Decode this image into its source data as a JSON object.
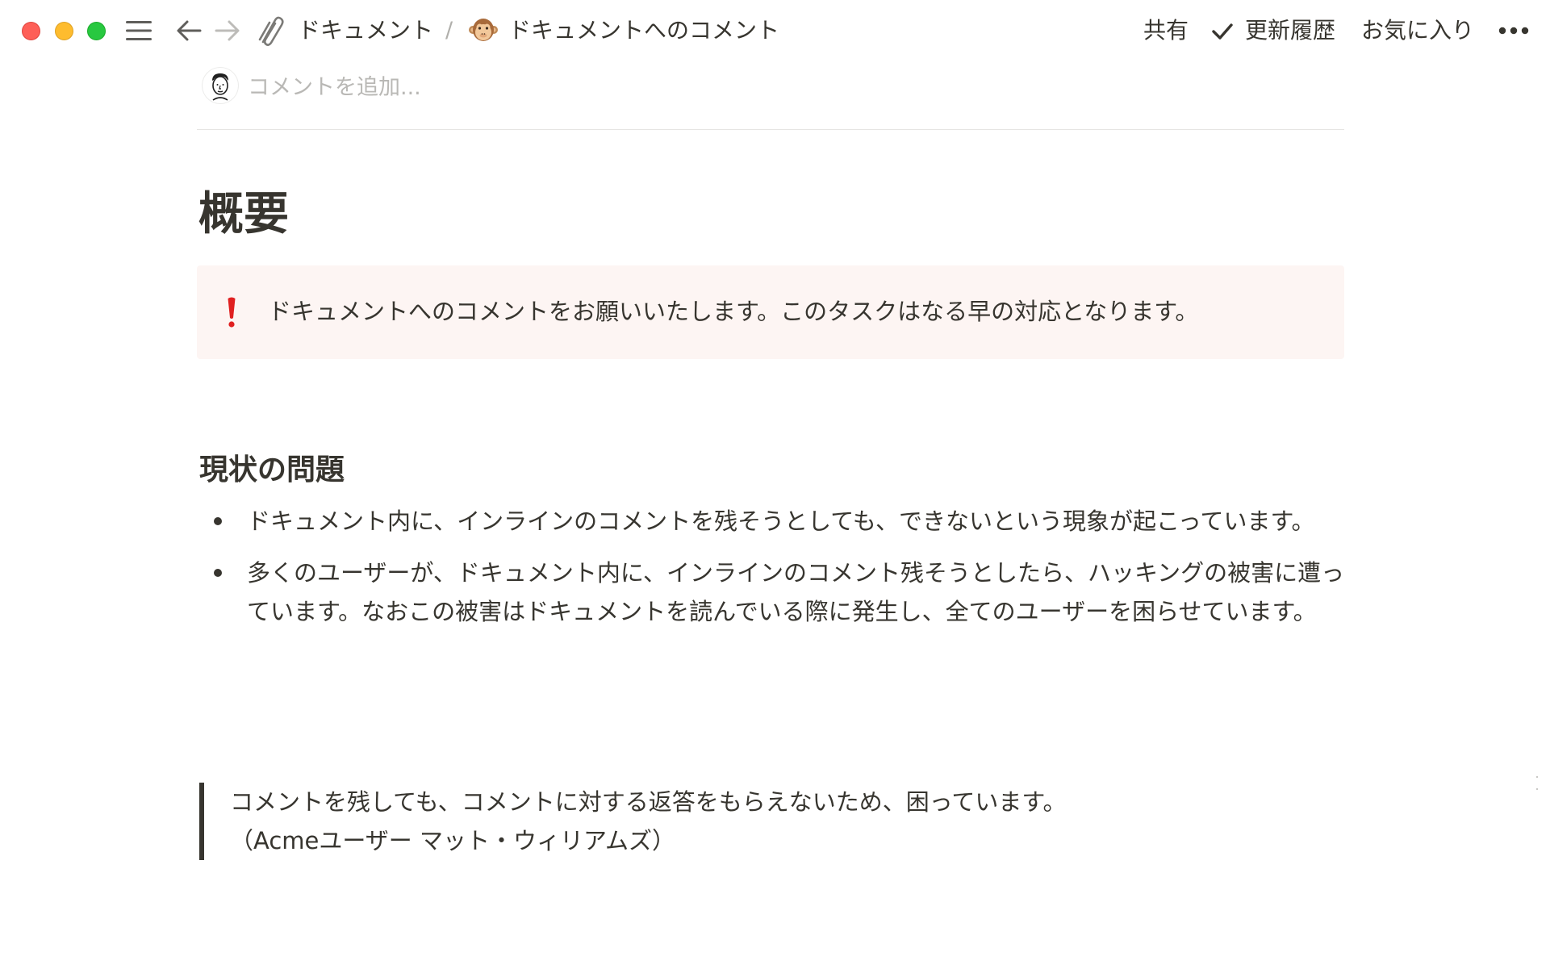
{
  "window": {
    "traffic_lights": {
      "close": "#fe5f57",
      "minimize": "#febc2e",
      "maximize": "#28c840"
    }
  },
  "toolbar": {
    "sidebar_toggle_icon": "menu-icon",
    "back_icon": "arrow-left-icon",
    "forward_icon": "arrow-right-icon",
    "breadcrumb": {
      "parent_icon": "paperclip-icon",
      "parent_label": "ドキュメント",
      "separator": "/",
      "current_icon": "monkey-face-emoji",
      "current_label": "ドキュメントへのコメント"
    },
    "actions": {
      "share_label": "共有",
      "updates_icon": "checkmark-icon",
      "updates_label": "更新履歴",
      "favorite_label": "お気に入り",
      "more_icon": "more-horizontal-icon"
    }
  },
  "comment_bar": {
    "placeholder": "コメントを追加..."
  },
  "page": {
    "title": "概要",
    "callout": {
      "icon": "exclamation-icon",
      "color": "#fdf5f3",
      "text": "ドキュメントへのコメントをお願いいたします。このタスクはなる早の対応となります。"
    },
    "section_heading": "現状の問題",
    "bullets": [
      "ドキュメント内に、インラインのコメントを残そうとしても、できないという現象が起こっています。",
      "多くのユーザーが、ドキュメント内に、インラインのコメント残そうとしたら、ハッキングの被害に遭っています。なおこの被害はドキュメントを読んでいる際に発生し、全てのユーザーを困らせています。"
    ],
    "quote": {
      "line1": "コメントを残しても、コメントに対する返答をもらえないため、困っています。",
      "line2": "（Acmeユーザー マット・ウィリアムズ）"
    }
  }
}
